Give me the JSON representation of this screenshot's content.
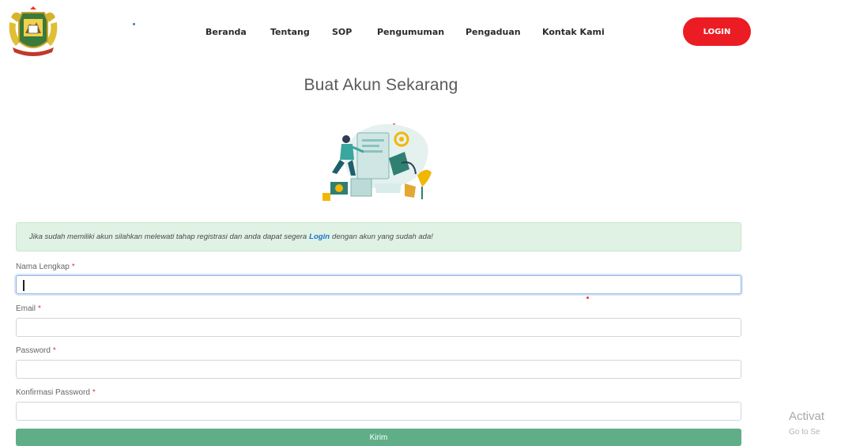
{
  "header": {
    "nav_items": [
      "Beranda",
      "Tentang",
      "SOP",
      "Pengumuman",
      "Pengaduan",
      "Kontak Kami"
    ],
    "login_label": "LOGIN"
  },
  "page_title": "Buat Akun Sekarang",
  "alert": {
    "text_before": "Jika sudah memiliki akun silahkan melewati tahap registrasi dan anda dapat segera",
    "link_label": "Login",
    "text_after": "dengan akun yang sudah ada!"
  },
  "form": {
    "full_name": {
      "label": "Nama Lengkap",
      "required_mark": "*",
      "value": ""
    },
    "email": {
      "label": "Email",
      "required_mark": "*",
      "value": ""
    },
    "password": {
      "label": "Password",
      "required_mark": "*",
      "value": ""
    },
    "confirm_password": {
      "label": "Konfirmasi Password",
      "required_mark": "*",
      "value": ""
    },
    "submit_label": "Kirim"
  },
  "watermark": {
    "title": "Activat",
    "subtitle": "Go to Se"
  },
  "colors": {
    "login": "#ec1c24",
    "submit": "#5fae87",
    "alert_bg": "#dff2e4",
    "link": "#1a6fd1"
  },
  "icons": {
    "logo": "government-emblem-icon",
    "illustration": "registration-illustration"
  }
}
